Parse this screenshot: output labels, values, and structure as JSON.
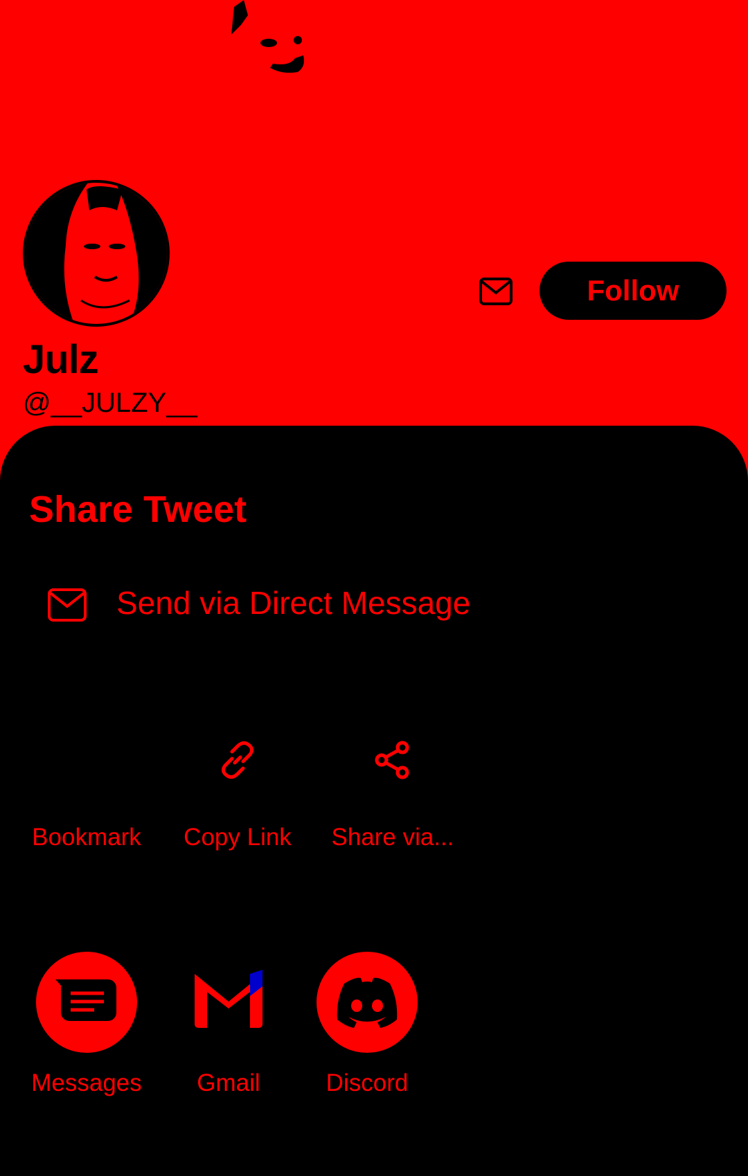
{
  "profile": {
    "display_name": "Julz",
    "handle": "@__JULZY__",
    "follow_label": "Follow"
  },
  "share_sheet": {
    "title": "Share Tweet",
    "direct_message_label": "Send via Direct Message",
    "actions": [
      {
        "label": "Bookmark",
        "icon": "bookmark-icon"
      },
      {
        "label": "Copy Link",
        "icon": "link-icon"
      },
      {
        "label": "Share via...",
        "icon": "share-icon"
      }
    ],
    "apps": [
      {
        "label": "Messages",
        "icon": "messages-app-icon"
      },
      {
        "label": "Gmail",
        "icon": "gmail-app-icon"
      },
      {
        "label": "Discord",
        "icon": "discord-app-icon"
      }
    ]
  },
  "colors": {
    "background": "#ff0000",
    "sheet": "#000000",
    "accent": "#ff0000",
    "gmail_accent": "#0000cc"
  }
}
